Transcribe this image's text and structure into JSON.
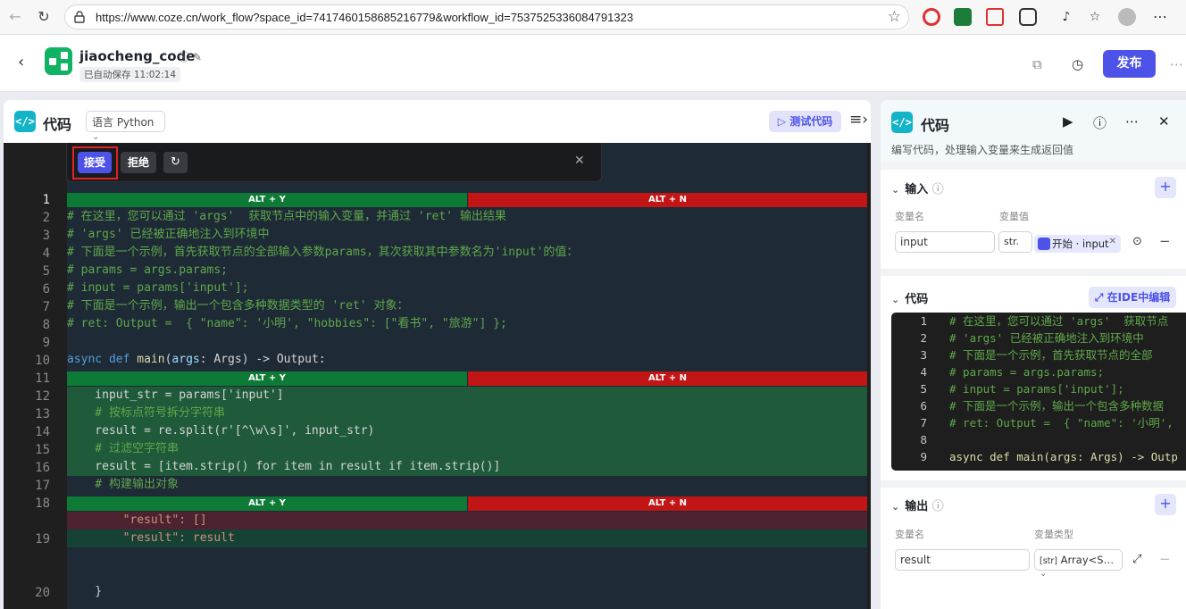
{
  "browser": {
    "url": "https://www.coze.cn/work_flow?space_id=7417460158685216779&workflow_id=7537525336084791323"
  },
  "header": {
    "title": "jiaocheng_code",
    "autosave": "已自动保存 11:02:14",
    "publish_label": "发布"
  },
  "left_panel": {
    "title": "代码",
    "code_icon": "</>",
    "language": "语言 Python",
    "test_label": "测试代码",
    "inline_actions": {
      "accept": "接受",
      "reject": "拒绝"
    },
    "diff_bar": {
      "accept_shortcut": "ALT + Y",
      "reject_shortcut": "ALT + N"
    },
    "line_numbers": [
      "1",
      "2",
      "3",
      "4",
      "5",
      "6",
      "7",
      "8",
      "9",
      "10",
      "11",
      "12",
      "13",
      "14",
      "15",
      "16",
      "17",
      "18",
      "19",
      "20"
    ],
    "code_lines": [
      "# 在这里，您可以通过 'args'  获取节点中的输入变量，并通过 'ret' 输出结果",
      "# 'args' 已经被正确地注入到环境中",
      "# 下面是一个示例，首先获取节点的全部输入参数params，其次获取其中参数名为'input'的值：",
      "# params = args.params;",
      "# input = params['input'];",
      "# 下面是一个示例，输出一个包含多种数据类型的 'ret' 对象：",
      "# ret: Output =  { \"name\": '小明', \"hobbies\": [\"看书\", \"旅游\"] };",
      "",
      "async def main(args: Args) -> Output:",
      "    input_str = params['input']",
      "    # 按标点符号拆分字符串",
      "    result = re.split(r'[^\\w\\s]', input_str)",
      "    # 过滤空字符串",
      "    result = [item.strip() for item in result if item.strip()]",
      "    # 构建输出对象",
      "        \"result\": []",
      "        \"result\": result",
      "    }"
    ]
  },
  "right_panel": {
    "title": "代码",
    "code_icon": "</>",
    "description": "编写代码，处理输入变量来生成返回值",
    "input_section": {
      "title": "输入",
      "col_name": "变量名",
      "col_value": "变量值",
      "var_name": "input",
      "type_short": "str.",
      "ref_label": "开始 · input"
    },
    "code_section": {
      "title": "代码",
      "ide_label": "在IDE中编辑",
      "line_numbers": [
        "1",
        "2",
        "3",
        "4",
        "5",
        "6",
        "7",
        "8",
        "9"
      ],
      "lines": [
        "# 在这里，您可以通过 'args'  获取节点",
        "# 'args' 已经被正确地注入到环境中",
        "# 下面是一个示例，首先获取节点的全部",
        "# params = args.params;",
        "# input = params['input'];",
        "# 下面是一个示例，输出一个包含多种数据",
        "# ret: Output =  { \"name\": '小明',",
        "",
        "async def main(args: Args) -> Outp"
      ]
    },
    "output_section": {
      "title": "输出",
      "col_name": "变量名",
      "col_type": "变量类型",
      "var_name": "result",
      "type_label": "Array<S…",
      "type_prefix": "[str]"
    }
  },
  "colors": {
    "accent": "#4d53e8",
    "diff_accept": "#0d7a36",
    "diff_reject": "#c21616",
    "code_icon": "#13b4c8",
    "logo": "#10b264"
  }
}
